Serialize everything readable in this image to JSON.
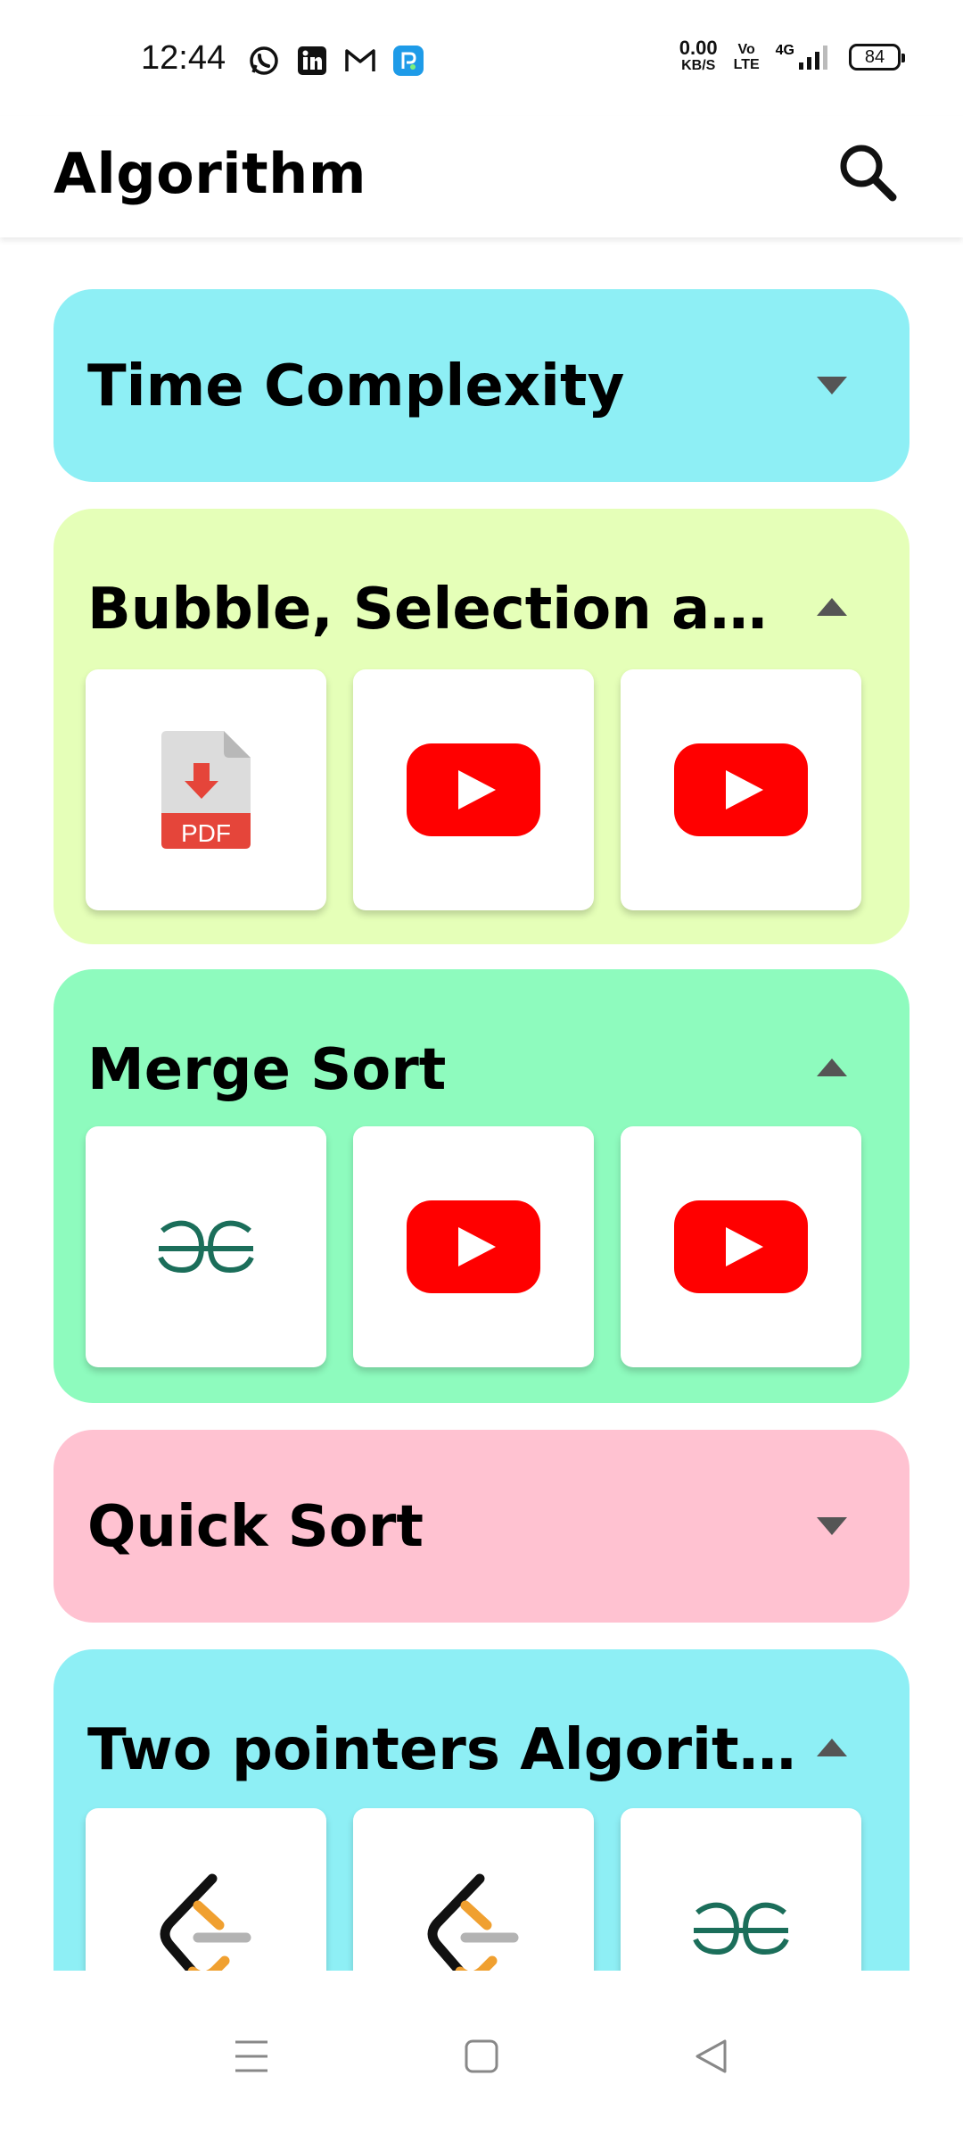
{
  "status_bar": {
    "time": "12:44",
    "net_speed_value": "0.00",
    "net_speed_unit": "KB/S",
    "volte_top": "Vo",
    "volte_bottom": "LTE",
    "network_type": "4G",
    "battery": "84",
    "notification_icons": [
      "whatsapp-icon",
      "linkedin-icon",
      "gmail-icon",
      "app-notification-icon"
    ]
  },
  "app_bar": {
    "title": "Algorithm",
    "search_icon": "search-icon"
  },
  "cards": [
    {
      "title": "Time Complexity",
      "color": "#8EEFF5",
      "expanded": false,
      "tiles": []
    },
    {
      "title": "Bubble, Selection an...",
      "color": "#E5FFB8",
      "expanded": true,
      "tiles": [
        "pdf-icon",
        "youtube-icon",
        "youtube-icon"
      ]
    },
    {
      "title": "Merge Sort",
      "color": "#8EFBBE",
      "expanded": true,
      "tiles": [
        "geeksforgeeks-icon",
        "youtube-icon",
        "youtube-icon"
      ]
    },
    {
      "title": "Quick Sort",
      "color": "#FFC2D1",
      "expanded": false,
      "tiles": []
    },
    {
      "title": "Two pointers Algorit...",
      "color": "#8EEFF5",
      "expanded": true,
      "tiles": [
        "leetcode-icon",
        "leetcode-icon",
        "geeksforgeeks-icon"
      ]
    }
  ],
  "pdf_label": "PDF",
  "nav_bar": {
    "buttons": [
      "menu-icon",
      "home-icon",
      "back-icon"
    ]
  }
}
